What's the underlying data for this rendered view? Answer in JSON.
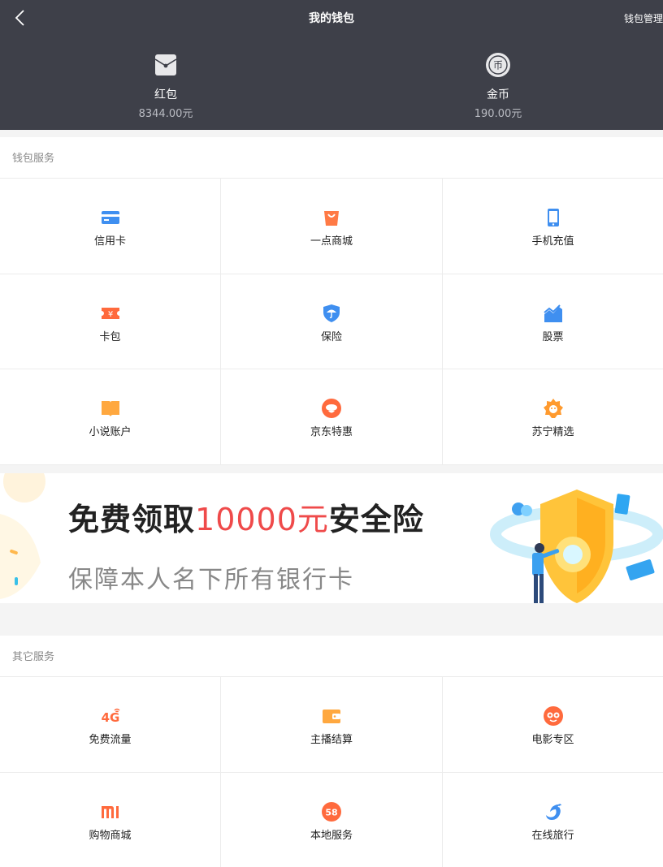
{
  "header": {
    "title": "我的钱包",
    "manage": "钱包管理",
    "assets": [
      {
        "label": "红包",
        "amount": "8344.00元"
      },
      {
        "label": "金币",
        "amount": "190.00元"
      }
    ]
  },
  "wallet_services": {
    "title": "钱包服务",
    "items": [
      {
        "label": "信用卡",
        "icon": "credit-card-icon"
      },
      {
        "label": "一点商城",
        "icon": "shopping-bag-icon"
      },
      {
        "label": "手机充值",
        "icon": "phone-icon"
      },
      {
        "label": "卡包",
        "icon": "ticket-icon"
      },
      {
        "label": "保险",
        "icon": "shield-umbrella-icon"
      },
      {
        "label": "股票",
        "icon": "stock-chart-icon"
      },
      {
        "label": "小说账户",
        "icon": "book-icon"
      },
      {
        "label": "京东特惠",
        "icon": "jd-dog-icon"
      },
      {
        "label": "苏宁精选",
        "icon": "suning-lion-icon"
      }
    ]
  },
  "banner": {
    "headline_prefix": "免费领取",
    "headline_highlight": "10000元",
    "headline_suffix": "安全险",
    "subline": "保障本人名下所有银行卡"
  },
  "other_services": {
    "title": "其它服务",
    "items": [
      {
        "label": "免费流量",
        "icon": "4g-icon"
      },
      {
        "label": "主播结算",
        "icon": "wallet-icon"
      },
      {
        "label": "电影专区",
        "icon": "movie-face-icon"
      },
      {
        "label": "购物商城",
        "icon": "mi-logo-icon"
      },
      {
        "label": "本地服务",
        "icon": "58-logo-icon"
      },
      {
        "label": "在线旅行",
        "icon": "dolphin-icon"
      }
    ]
  },
  "colors": {
    "header_bg": "#3e4049",
    "blue": "#3f8ff0",
    "orange": "#ff7a45",
    "red_highlight": "#ef4a4a"
  }
}
